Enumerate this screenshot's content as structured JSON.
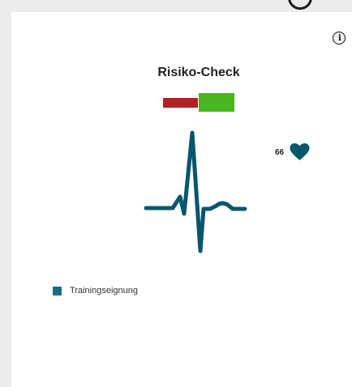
{
  "card": {
    "title": "Risiko-Check",
    "info_button_label": "i",
    "heart_rate": "66",
    "risk_indicator": {
      "left_segment_color": "#b51f23",
      "right_segment_color": "#47b620",
      "selected_side": "right"
    },
    "ecg_color": "#06566c",
    "heart_icon_color": "#06566c",
    "legend": {
      "label": "Trainingseignung",
      "color": "#1a6d85"
    }
  },
  "icons": {
    "info": "info-icon",
    "heart": "heart-icon",
    "ecg": "ecg-waveform-icon"
  }
}
